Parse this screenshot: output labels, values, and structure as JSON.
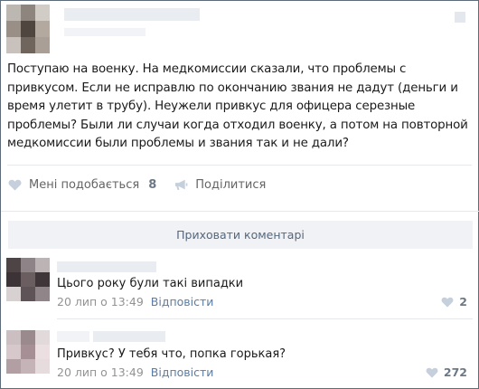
{
  "post": {
    "text": "Поступаю на военку. На медкомиссии сказали, что проблемы с привкусом. Если не исправлю по окончанию звания не дадут (деньги и время улетит в трубу). Неужели привкус для офицера серезные проблемы? Были ли случаи когда отходил военку, а потом на повторной медкомиссии были проблемы и звания так и не дали?",
    "icons": [
      "more-icon"
    ]
  },
  "actions": {
    "like_label": "Мені подобається",
    "like_count": "8",
    "share_label": "Поділитися",
    "icons": [
      "heart-icon",
      "megaphone-icon"
    ]
  },
  "comments": {
    "hide_label": "Приховати коментарі",
    "items": [
      {
        "text": "Цього року були такі випадки",
        "time": "20 лип о 13:49",
        "reply_label": "Відповісти",
        "likes": "2"
      },
      {
        "text": "Привкус? У тебя что, попка горькая?",
        "time": "20 лип о 13:49",
        "reply_label": "Відповісти",
        "likes": "272"
      }
    ]
  },
  "colors": {
    "link": "#5b7ca3",
    "muted": "#939393",
    "button_bg": "#f0f2f5",
    "heart": "#c5d0dc"
  }
}
